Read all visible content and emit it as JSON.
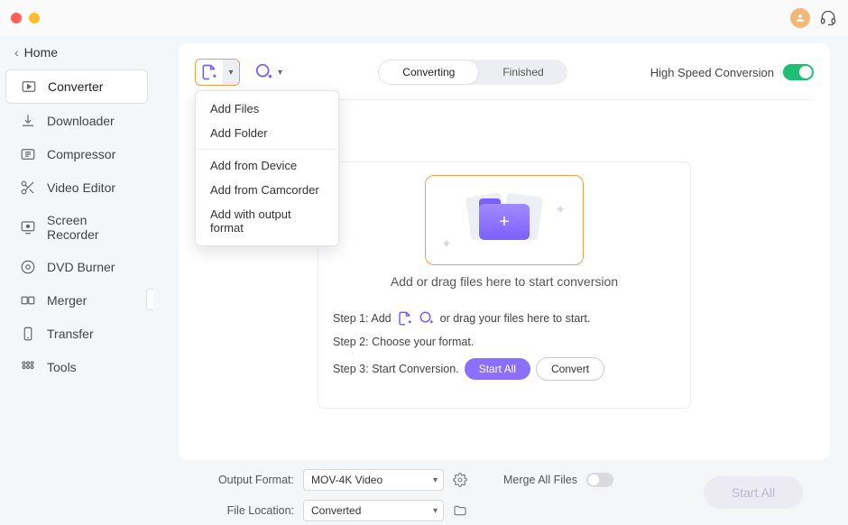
{
  "window": {
    "home_label": "Home"
  },
  "sidebar": {
    "items": [
      {
        "label": "Converter",
        "active": true
      },
      {
        "label": "Downloader"
      },
      {
        "label": "Compressor"
      },
      {
        "label": "Video Editor"
      },
      {
        "label": "Screen Recorder"
      },
      {
        "label": "DVD Burner"
      },
      {
        "label": "Merger"
      },
      {
        "label": "Transfer"
      },
      {
        "label": "Tools"
      }
    ]
  },
  "toolbar": {
    "tabs": {
      "converting": "Converting",
      "finished": "Finished"
    },
    "high_speed_label": "High Speed Conversion"
  },
  "add_menu": {
    "add_files": "Add Files",
    "add_folder": "Add Folder",
    "add_device": "Add from Device",
    "add_camcorder": "Add from Camcorder",
    "add_output": "Add with output format"
  },
  "dropzone": {
    "hint": "Add or drag files here to start conversion",
    "step1_pre": "Step 1: Add",
    "step1_post": "or drag your files here to start.",
    "step2": "Step 2: Choose your format.",
    "step3": "Step 3: Start Conversion.",
    "start_all_btn": "Start  All",
    "convert_btn": "Convert"
  },
  "footer": {
    "output_format_label": "Output Format:",
    "output_format_value": "MOV-4K Video",
    "file_location_label": "File Location:",
    "file_location_value": "Converted",
    "merge_label": "Merge All Files",
    "start_all": "Start All"
  }
}
